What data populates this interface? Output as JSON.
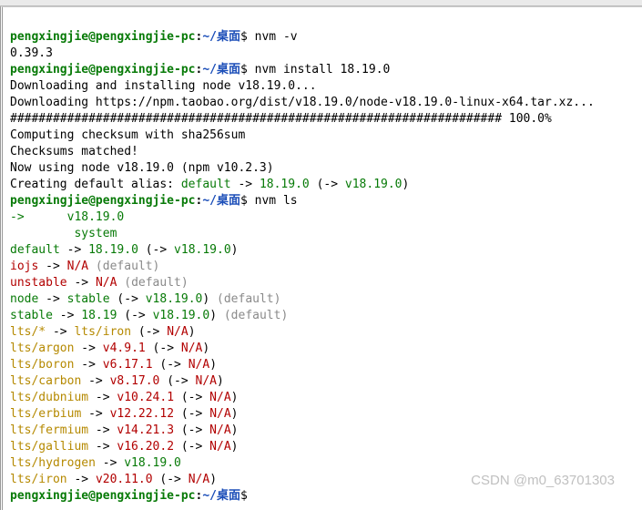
{
  "prompt": {
    "user": "pengxingjie@pengxingjie-pc",
    "path": "~/桌面",
    "sep": ":",
    "suffix": "$"
  },
  "cmd": {
    "nvm_v": "nvm -v",
    "nvm_v_out": "0.39.3",
    "nvm_install": "nvm install 18.19.0",
    "nvm_ls": "nvm ls"
  },
  "install": {
    "line1": "Downloading and installing node v18.19.0...",
    "line2": "Downloading https://npm.taobao.org/dist/v18.19.0/node-v18.19.0-linux-x64.tar.xz...",
    "progress": "##################################################################### 100.0%",
    "line4": "Computing checksum with sha256sum",
    "line5": "Checksums matched!",
    "line6": "Now using node v18.19.0 (npm v10.2.3)",
    "alias_pre": "Creating default alias: ",
    "alias_default": "default",
    "alias_arrow": " -> ",
    "alias_ver": "18.19.0",
    "alias_paren_open": " (-> ",
    "alias_resolved": "v18.19.0",
    "alias_paren_close": ")"
  },
  "ls": {
    "cur_arrow": "->",
    "cur_ver": "v18.19.0",
    "system": "system",
    "default_label": "default",
    "default_ver": "18.19.0",
    "default_res": "v18.19.0",
    "iojs": "iojs",
    "na": "N/A",
    "def_txt": " (default)",
    "unstable": "unstable",
    "node": "node",
    "stable_word": "stable",
    "node_res": "v18.19.0",
    "stable_ver": "18.19",
    "stable_res": "v18.19.0",
    "lts_star": "lts/*",
    "lts_iron": "lts/iron",
    "argon": "lts/argon",
    "argon_v": "v4.9.1",
    "boron": "lts/boron",
    "boron_v": "v6.17.1",
    "carbon": "lts/carbon",
    "carbon_v": "v8.17.0",
    "dubnium": "lts/dubnium",
    "dubnium_v": "v10.24.1",
    "erbium": "lts/erbium",
    "erbium_v": "v12.22.12",
    "fermium": "lts/fermium",
    "fermium_v": "v14.21.3",
    "gallium": "lts/gallium",
    "gallium_v": "v16.20.2",
    "hydrogen": "lts/hydrogen",
    "hydrogen_v": "v18.19.0",
    "iron": "lts/iron",
    "iron_v": "v20.11.0",
    "arrow": " -> ",
    "paren_open": " (-> ",
    "paren_close": ")"
  },
  "watermark": "CSDN @m0_63701303"
}
